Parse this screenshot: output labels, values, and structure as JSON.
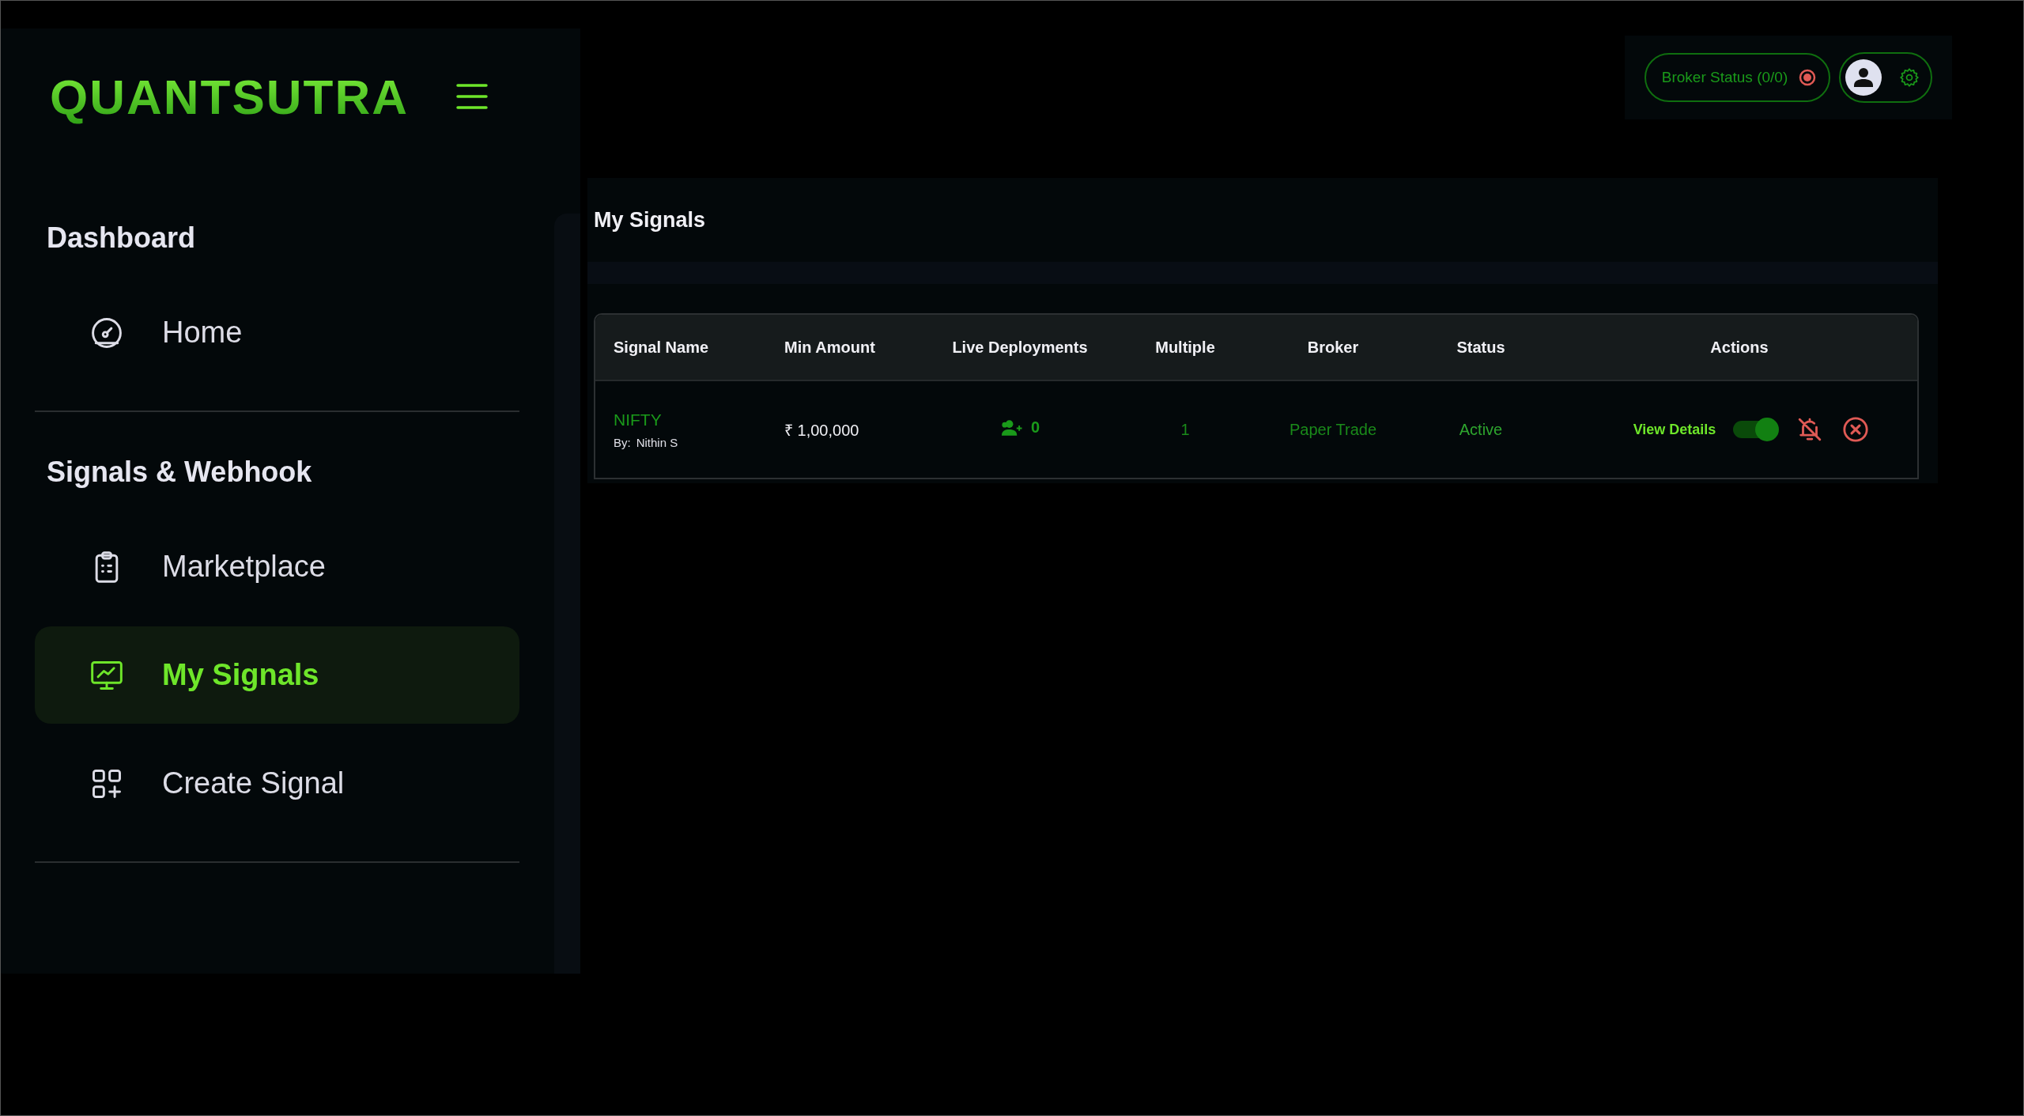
{
  "sidebar": {
    "logo": "QUANTSUTRA",
    "sections": [
      {
        "title": "Dashboard",
        "items": [
          {
            "label": "Home",
            "selected": false
          }
        ]
      },
      {
        "title": "Signals & Webhook",
        "items": [
          {
            "label": "Marketplace",
            "selected": false
          },
          {
            "label": "My Signals",
            "selected": true
          },
          {
            "label": "Create Signal",
            "selected": false
          }
        ]
      }
    ]
  },
  "header": {
    "broker_status": {
      "label": "Broker Status (0/0)",
      "connected": false
    }
  },
  "page_title": "My Signals",
  "table": {
    "columns": [
      "Signal Name",
      "Min Amount",
      "Live Deployments",
      "Multiple",
      "Broker",
      "Status",
      "Actions"
    ],
    "rows": [
      {
        "name": "NIFTY",
        "author_label": "By:",
        "author": "Nithin S",
        "min_amount": "₹ 1,00,000",
        "live_deployments": "0",
        "multiple": "1",
        "broker": "Paper Trade",
        "status": "Active",
        "view_details": "View Details",
        "enabled": true
      }
    ]
  }
}
